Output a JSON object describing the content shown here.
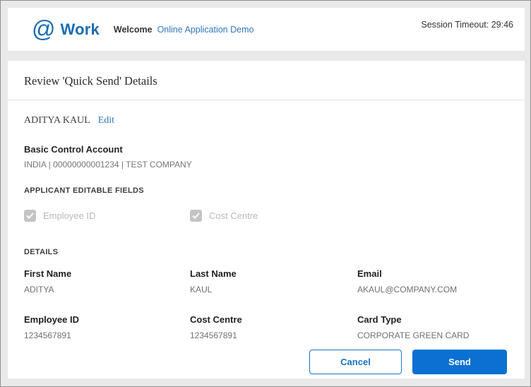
{
  "header": {
    "logo_at": "@",
    "logo_word": "Work",
    "welcome_label": "Welcome",
    "welcome_link": "Online Application Demo",
    "session_timeout": "Session Timeout: 29:46"
  },
  "page": {
    "title": "Review 'Quick Send' Details"
  },
  "applicant": {
    "name": "ADITYA KAUL",
    "edit_link": "Edit"
  },
  "account": {
    "label": "Basic Control Account",
    "value": "INDIA | 00000000001234 | TEST COMPANY"
  },
  "editable_fields": {
    "heading": "APPLICANT EDITABLE FIELDS",
    "items": [
      {
        "label": "Employee ID",
        "checked": true,
        "disabled": true
      },
      {
        "label": "Cost Centre",
        "checked": true,
        "disabled": true
      }
    ]
  },
  "details": {
    "heading": "DETAILS",
    "fields": [
      {
        "label": "First Name",
        "value": "ADITYA"
      },
      {
        "label": "Last Name",
        "value": "KAUL"
      },
      {
        "label": "Email",
        "value": "AKAUL@COMPANY.COM"
      },
      {
        "label": "Employee ID",
        "value": "1234567891"
      },
      {
        "label": "Cost Centre",
        "value": "1234567891"
      },
      {
        "label": "Card Type",
        "value": "CORPORATE GREEN CARD"
      }
    ]
  },
  "actions": {
    "cancel_label": "Cancel",
    "send_label": "Send"
  },
  "colors": {
    "brand_blue": "#1a6cb3",
    "link_blue": "#2e77bc",
    "button_blue": "#0b70d1",
    "page_bg": "#e9e9ea",
    "checkbox_gray": "#c4c4c4"
  }
}
